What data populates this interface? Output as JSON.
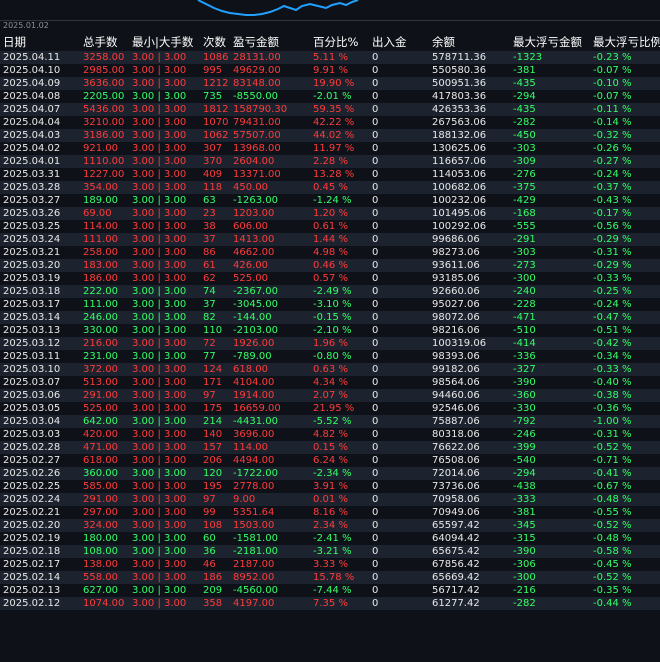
{
  "chart": {
    "axis_label": "2025.01.02",
    "line_color": "#22a0ff"
  },
  "colors": {
    "profit": "#ff3b3b",
    "loss": "#33ff66",
    "band": "#1c232e",
    "background": "#0e1118"
  },
  "table": {
    "headers": [
      "日期",
      "总手数",
      "最小|大手数",
      "次数",
      "盈亏金额",
      "百分比%",
      "出入金",
      "余额",
      "最大浮亏金额",
      "最大浮亏比例"
    ],
    "rows": [
      {
        "date": "2025.04.11",
        "lots": "3258.00",
        "minmax": "3.00 | 3.00",
        "count": "1086",
        "pl": "28131.00",
        "pct": "5.11 %",
        "dep": "0",
        "bal": "578711.36",
        "mfa": "-1323",
        "mfp": "-0.23 %",
        "status": "up"
      },
      {
        "date": "2025.04.10",
        "lots": "2985.00",
        "minmax": "3.00 | 3.00",
        "count": "995",
        "pl": "49629.00",
        "pct": "9.91 %",
        "dep": "0",
        "bal": "550580.36",
        "mfa": "-381",
        "mfp": "-0.07 %",
        "status": "up"
      },
      {
        "date": "2025.04.09",
        "lots": "3636.00",
        "minmax": "3.00 | 3.00",
        "count": "1212",
        "pl": "83148.00",
        "pct": "19.90 %",
        "dep": "0",
        "bal": "500951.36",
        "mfa": "-435",
        "mfp": "-0.10 %",
        "status": "up"
      },
      {
        "date": "2025.04.08",
        "lots": "2205.00",
        "minmax": "3.00 | 3.00",
        "count": "735",
        "pl": "-8550.00",
        "pct": "-2.01 %",
        "dep": "0",
        "bal": "417803.36",
        "mfa": "-294",
        "mfp": "-0.07 %",
        "status": "down"
      },
      {
        "date": "2025.04.07",
        "lots": "5436.00",
        "minmax": "3.00 | 3.00",
        "count": "1812",
        "pl": "158790.30",
        "pct": "59.35 %",
        "dep": "0",
        "bal": "426353.36",
        "mfa": "-435",
        "mfp": "-0.11 %",
        "status": "up"
      },
      {
        "date": "2025.04.04",
        "lots": "3210.00",
        "minmax": "3.00 | 3.00",
        "count": "1070",
        "pl": "79431.00",
        "pct": "42.22 %",
        "dep": "0",
        "bal": "267563.06",
        "mfa": "-282",
        "mfp": "-0.14 %",
        "status": "up"
      },
      {
        "date": "2025.04.03",
        "lots": "3186.00",
        "minmax": "3.00 | 3.00",
        "count": "1062",
        "pl": "57507.00",
        "pct": "44.02 %",
        "dep": "0",
        "bal": "188132.06",
        "mfa": "-450",
        "mfp": "-0.32 %",
        "status": "up"
      },
      {
        "date": "2025.04.02",
        "lots": "921.00",
        "minmax": "3.00 | 3.00",
        "count": "307",
        "pl": "13968.00",
        "pct": "11.97 %",
        "dep": "0",
        "bal": "130625.06",
        "mfa": "-303",
        "mfp": "-0.26 %",
        "status": "up"
      },
      {
        "date": "2025.04.01",
        "lots": "1110.00",
        "minmax": "3.00 | 3.00",
        "count": "370",
        "pl": "2604.00",
        "pct": "2.28 %",
        "dep": "0",
        "bal": "116657.06",
        "mfa": "-309",
        "mfp": "-0.27 %",
        "status": "up"
      },
      {
        "date": "2025.03.31",
        "lots": "1227.00",
        "minmax": "3.00 | 3.00",
        "count": "409",
        "pl": "13371.00",
        "pct": "13.28 %",
        "dep": "0",
        "bal": "114053.06",
        "mfa": "-276",
        "mfp": "-0.24 %",
        "status": "up"
      },
      {
        "date": "2025.03.28",
        "lots": "354.00",
        "minmax": "3.00 | 3.00",
        "count": "118",
        "pl": "450.00",
        "pct": "0.45 %",
        "dep": "0",
        "bal": "100682.06",
        "mfa": "-375",
        "mfp": "-0.37 %",
        "status": "up"
      },
      {
        "date": "2025.03.27",
        "lots": "189.00",
        "minmax": "3.00 | 3.00",
        "count": "63",
        "pl": "-1263.00",
        "pct": "-1.24 %",
        "dep": "0",
        "bal": "100232.06",
        "mfa": "-429",
        "mfp": "-0.43 %",
        "status": "down"
      },
      {
        "date": "2025.03.26",
        "lots": "69.00",
        "minmax": "3.00 | 3.00",
        "count": "23",
        "pl": "1203.00",
        "pct": "1.20 %",
        "dep": "0",
        "bal": "101495.06",
        "mfa": "-168",
        "mfp": "-0.17 %",
        "status": "up"
      },
      {
        "date": "2025.03.25",
        "lots": "114.00",
        "minmax": "3.00 | 3.00",
        "count": "38",
        "pl": "606.00",
        "pct": "0.61 %",
        "dep": "0",
        "bal": "100292.06",
        "mfa": "-555",
        "mfp": "-0.56 %",
        "status": "up"
      },
      {
        "date": "2025.03.24",
        "lots": "111.00",
        "minmax": "3.00 | 3.00",
        "count": "37",
        "pl": "1413.00",
        "pct": "1.44 %",
        "dep": "0",
        "bal": "99686.06",
        "mfa": "-291",
        "mfp": "-0.29 %",
        "status": "up"
      },
      {
        "date": "2025.03.21",
        "lots": "258.00",
        "minmax": "3.00 | 3.00",
        "count": "86",
        "pl": "4662.00",
        "pct": "4.98 %",
        "dep": "0",
        "bal": "98273.06",
        "mfa": "-303",
        "mfp": "-0.31 %",
        "status": "up"
      },
      {
        "date": "2025.03.20",
        "lots": "183.00",
        "minmax": "3.00 | 3.00",
        "count": "61",
        "pl": "426.00",
        "pct": "0.46 %",
        "dep": "0",
        "bal": "93611.06",
        "mfa": "-273",
        "mfp": "-0.29 %",
        "status": "up"
      },
      {
        "date": "2025.03.19",
        "lots": "186.00",
        "minmax": "3.00 | 3.00",
        "count": "62",
        "pl": "525.00",
        "pct": "0.57 %",
        "dep": "0",
        "bal": "93185.06",
        "mfa": "-300",
        "mfp": "-0.33 %",
        "status": "up"
      },
      {
        "date": "2025.03.18",
        "lots": "222.00",
        "minmax": "3.00 | 3.00",
        "count": "74",
        "pl": "-2367.00",
        "pct": "-2.49 %",
        "dep": "0",
        "bal": "92660.06",
        "mfa": "-240",
        "mfp": "-0.25 %",
        "status": "down"
      },
      {
        "date": "2025.03.17",
        "lots": "111.00",
        "minmax": "3.00 | 3.00",
        "count": "37",
        "pl": "-3045.00",
        "pct": "-3.10 %",
        "dep": "0",
        "bal": "95027.06",
        "mfa": "-228",
        "mfp": "-0.24 %",
        "status": "down"
      },
      {
        "date": "2025.03.14",
        "lots": "246.00",
        "minmax": "3.00 | 3.00",
        "count": "82",
        "pl": "-144.00",
        "pct": "-0.15 %",
        "dep": "0",
        "bal": "98072.06",
        "mfa": "-471",
        "mfp": "-0.47 %",
        "status": "down"
      },
      {
        "date": "2025.03.13",
        "lots": "330.00",
        "minmax": "3.00 | 3.00",
        "count": "110",
        "pl": "-2103.00",
        "pct": "-2.10 %",
        "dep": "0",
        "bal": "98216.06",
        "mfa": "-510",
        "mfp": "-0.51 %",
        "status": "down"
      },
      {
        "date": "2025.03.12",
        "lots": "216.00",
        "minmax": "3.00 | 3.00",
        "count": "72",
        "pl": "1926.00",
        "pct": "1.96 %",
        "dep": "0",
        "bal": "100319.06",
        "mfa": "-414",
        "mfp": "-0.42 %",
        "status": "up"
      },
      {
        "date": "2025.03.11",
        "lots": "231.00",
        "minmax": "3.00 | 3.00",
        "count": "77",
        "pl": "-789.00",
        "pct": "-0.80 %",
        "dep": "0",
        "bal": "98393.06",
        "mfa": "-336",
        "mfp": "-0.34 %",
        "status": "down"
      },
      {
        "date": "2025.03.10",
        "lots": "372.00",
        "minmax": "3.00 | 3.00",
        "count": "124",
        "pl": "618.00",
        "pct": "0.63 %",
        "dep": "0",
        "bal": "99182.06",
        "mfa": "-327",
        "mfp": "-0.33 %",
        "status": "up"
      },
      {
        "date": "2025.03.07",
        "lots": "513.00",
        "minmax": "3.00 | 3.00",
        "count": "171",
        "pl": "4104.00",
        "pct": "4.34 %",
        "dep": "0",
        "bal": "98564.06",
        "mfa": "-390",
        "mfp": "-0.40 %",
        "status": "up"
      },
      {
        "date": "2025.03.06",
        "lots": "291.00",
        "minmax": "3.00 | 3.00",
        "count": "97",
        "pl": "1914.00",
        "pct": "2.07 %",
        "dep": "0",
        "bal": "94460.06",
        "mfa": "-360",
        "mfp": "-0.38 %",
        "status": "up"
      },
      {
        "date": "2025.03.05",
        "lots": "525.00",
        "minmax": "3.00 | 3.00",
        "count": "175",
        "pl": "16659.00",
        "pct": "21.95 %",
        "dep": "0",
        "bal": "92546.06",
        "mfa": "-330",
        "mfp": "-0.36 %",
        "status": "up"
      },
      {
        "date": "2025.03.04",
        "lots": "642.00",
        "minmax": "3.00 | 3.00",
        "count": "214",
        "pl": "-4431.00",
        "pct": "-5.52 %",
        "dep": "0",
        "bal": "75887.06",
        "mfa": "-792",
        "mfp": "-1.00 %",
        "status": "down"
      },
      {
        "date": "2025.03.03",
        "lots": "420.00",
        "minmax": "3.00 | 3.00",
        "count": "140",
        "pl": "3696.00",
        "pct": "4.82 %",
        "dep": "0",
        "bal": "80318.06",
        "mfa": "-246",
        "mfp": "-0.31 %",
        "status": "up"
      },
      {
        "date": "2025.02.28",
        "lots": "471.00",
        "minmax": "3.00 | 3.00",
        "count": "157",
        "pl": "114.00",
        "pct": "0.15 %",
        "dep": "0",
        "bal": "76622.06",
        "mfa": "-399",
        "mfp": "-0.52 %",
        "status": "up"
      },
      {
        "date": "2025.02.27",
        "lots": "618.00",
        "minmax": "3.00 | 3.00",
        "count": "206",
        "pl": "4494.00",
        "pct": "6.24 %",
        "dep": "0",
        "bal": "76508.06",
        "mfa": "-540",
        "mfp": "-0.71 %",
        "status": "up"
      },
      {
        "date": "2025.02.26",
        "lots": "360.00",
        "minmax": "3.00 | 3.00",
        "count": "120",
        "pl": "-1722.00",
        "pct": "-2.34 %",
        "dep": "0",
        "bal": "72014.06",
        "mfa": "-294",
        "mfp": "-0.41 %",
        "status": "down"
      },
      {
        "date": "2025.02.25",
        "lots": "585.00",
        "minmax": "3.00 | 3.00",
        "count": "195",
        "pl": "2778.00",
        "pct": "3.91 %",
        "dep": "0",
        "bal": "73736.06",
        "mfa": "-438",
        "mfp": "-0.67 %",
        "status": "up"
      },
      {
        "date": "2025.02.24",
        "lots": "291.00",
        "minmax": "3.00 | 3.00",
        "count": "97",
        "pl": "9.00",
        "pct": "0.01 %",
        "dep": "0",
        "bal": "70958.06",
        "mfa": "-333",
        "mfp": "-0.48 %",
        "status": "up"
      },
      {
        "date": "2025.02.21",
        "lots": "297.00",
        "minmax": "3.00 | 3.00",
        "count": "99",
        "pl": "5351.64",
        "pct": "8.16 %",
        "dep": "0",
        "bal": "70949.06",
        "mfa": "-381",
        "mfp": "-0.55 %",
        "status": "up"
      },
      {
        "date": "2025.02.20",
        "lots": "324.00",
        "minmax": "3.00 | 3.00",
        "count": "108",
        "pl": "1503.00",
        "pct": "2.34 %",
        "dep": "0",
        "bal": "65597.42",
        "mfa": "-345",
        "mfp": "-0.52 %",
        "status": "up"
      },
      {
        "date": "2025.02.19",
        "lots": "180.00",
        "minmax": "3.00 | 3.00",
        "count": "60",
        "pl": "-1581.00",
        "pct": "-2.41 %",
        "dep": "0",
        "bal": "64094.42",
        "mfa": "-315",
        "mfp": "-0.48 %",
        "status": "down"
      },
      {
        "date": "2025.02.18",
        "lots": "108.00",
        "minmax": "3.00 | 3.00",
        "count": "36",
        "pl": "-2181.00",
        "pct": "-3.21 %",
        "dep": "0",
        "bal": "65675.42",
        "mfa": "-390",
        "mfp": "-0.58 %",
        "status": "down"
      },
      {
        "date": "2025.02.17",
        "lots": "138.00",
        "minmax": "3.00 | 3.00",
        "count": "46",
        "pl": "2187.00",
        "pct": "3.33 %",
        "dep": "0",
        "bal": "67856.42",
        "mfa": "-306",
        "mfp": "-0.45 %",
        "status": "up"
      },
      {
        "date": "2025.02.14",
        "lots": "558.00",
        "minmax": "3.00 | 3.00",
        "count": "186",
        "pl": "8952.00",
        "pct": "15.78 %",
        "dep": "0",
        "bal": "65669.42",
        "mfa": "-300",
        "mfp": "-0.52 %",
        "status": "up"
      },
      {
        "date": "2025.02.13",
        "lots": "627.00",
        "minmax": "3.00 | 3.00",
        "count": "209",
        "pl": "-4560.00",
        "pct": "-7.44 %",
        "dep": "0",
        "bal": "56717.42",
        "mfa": "-216",
        "mfp": "-0.35 %",
        "status": "down"
      },
      {
        "date": "2025.02.12",
        "lots": "1074.00",
        "minmax": "3.00 | 3.00",
        "count": "358",
        "pl": "4197.00",
        "pct": "7.35 %",
        "dep": "0",
        "bal": "61277.42",
        "mfa": "-282",
        "mfp": "-0.44 %",
        "status": "up"
      }
    ]
  }
}
